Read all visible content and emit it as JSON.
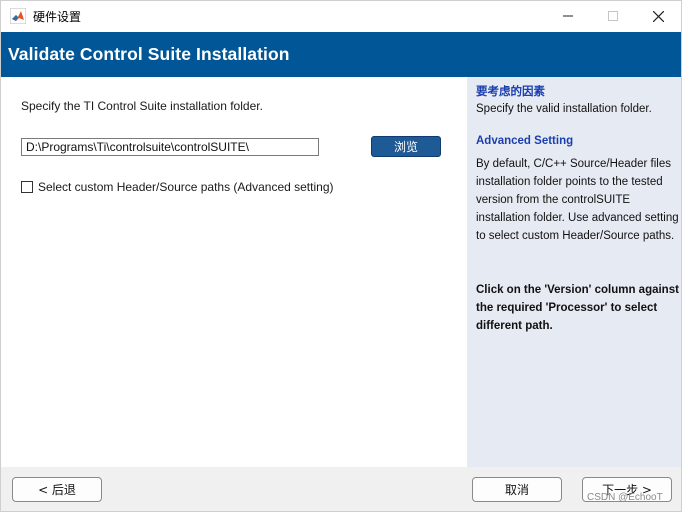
{
  "window": {
    "title": "硬件设置",
    "icon": "matlab-icon",
    "controls": {
      "minimize": "minimize-icon",
      "maximize": "maximize-icon",
      "close": "close-icon"
    }
  },
  "banner": {
    "title": "Validate Control Suite Installation"
  },
  "main": {
    "instruction": "Specify the TI Control Suite installation folder.",
    "path_value": "D:\\Programs\\Ti\\controlsuite\\controlSUITE\\",
    "browse_label": "浏览",
    "checkbox_label": "Select custom Header/Source paths (Advanced setting)",
    "checkbox_checked": false
  },
  "help": {
    "heading1": "要考虑的因素",
    "para1": "Specify the valid installation folder.",
    "heading2": "Advanced Setting",
    "para2": "By default, C/C++ Source/Header files installation folder points to the tested version from the controlSUITE installation folder. Use advanced setting to select custom Header/Source paths.",
    "para3": "Click on the 'Version' column against the required 'Processor' to select different path."
  },
  "footer": {
    "back_label": "< 后退",
    "cancel_label": "取消",
    "next_label": "下一步 >",
    "watermark": "CSDN @EchooT"
  },
  "colors": {
    "banner": "#005696",
    "help_panel": "#e6eaf2",
    "help_heading": "#1b3fb0",
    "browse_button": "#1e5a96"
  }
}
